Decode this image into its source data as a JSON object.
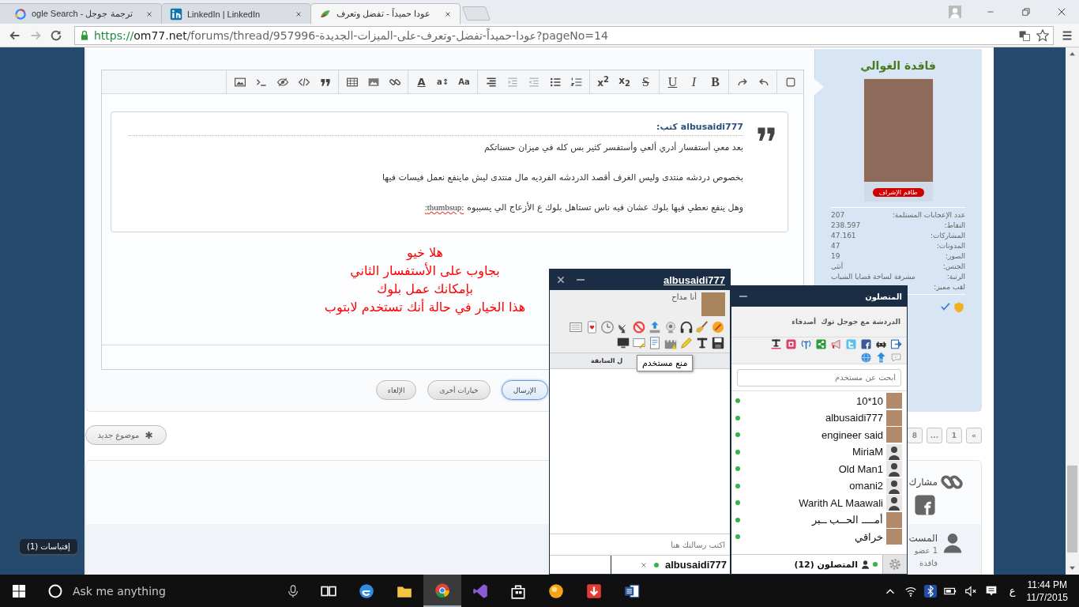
{
  "browser": {
    "tabs": [
      {
        "title": "عودا حميداً - تفضل وتعرف",
        "kind": "forum",
        "selected": true
      },
      {
        "title": "LinkedIn | LinkedIn",
        "kind": "linkedin",
        "selected": false
      },
      {
        "title": "ogle Search - ترجمة جوجل",
        "kind": "google",
        "selected": false
      }
    ],
    "address": {
      "secure": true,
      "scheme": "https://",
      "host": "om77.net",
      "path": "/forums/thread/957996-عودا-حميداً-تفضل-وتعرف-على-الميزات-الجديدة?pageNo=14"
    }
  },
  "editor": {
    "toolbar": [
      [
        {
          "kind": "square",
          "disabled": false
        }
      ],
      [
        {
          "kind": "undo",
          "disabled": false
        },
        {
          "kind": "redo",
          "disabled": false
        }
      ],
      [
        {
          "kind": "bold",
          "text": "B",
          "disabled": false
        },
        {
          "kind": "italic",
          "text": "I",
          "disabled": false
        },
        {
          "kind": "underline",
          "text": "U",
          "disabled": false
        }
      ],
      [
        {
          "kind": "strike",
          "text": "S",
          "disabled": false
        },
        {
          "kind": "subscript",
          "text": "x$_{2}$",
          "disabled": false
        },
        {
          "kind": "superscript",
          "text": "x$^{2}$",
          "disabled": false
        }
      ],
      [
        {
          "kind": "numbered",
          "disabled": false
        },
        {
          "kind": "bullets",
          "disabled": false
        },
        {
          "kind": "outdent",
          "disabled": true
        },
        {
          "kind": "indent",
          "disabled": true
        },
        {
          "kind": "align-right",
          "disabled": false
        }
      ],
      [
        {
          "kind": "font",
          "text": "Aa",
          "disabled": false
        },
        {
          "kind": "font-size",
          "text": "a↕",
          "disabled": false
        },
        {
          "kind": "text-color",
          "text": "A",
          "disabled": false
        }
      ],
      [
        {
          "kind": "link",
          "disabled": false
        },
        {
          "kind": "picture",
          "disabled": false
        },
        {
          "kind": "table",
          "disabled": false
        }
      ],
      [
        {
          "kind": "quote",
          "disabled": false
        },
        {
          "kind": "code",
          "disabled": false
        },
        {
          "kind": "hide",
          "disabled": false
        },
        {
          "kind": "terminal",
          "disabled": false
        },
        {
          "kind": "image",
          "disabled": false
        }
      ]
    ],
    "quote": {
      "author": "albusaidi777 كتب:",
      "lines": [
        {
          "text": "بعد معي أستفسار أدري ألعي وأستفسر كثير بس كله في ميزان حسناتكم"
        },
        {
          "text": "بخصوص دردشه منتدى وليس الغرف أقصد الدردشه الفرديه مال منتدى ليش ماينفع نعمل فيسات فيها"
        },
        {
          "text": "وهل ينفع نعطي فيها بلوك عشان فيه ناس تستاهل بلوك ع الأزعاج الي يسببوه",
          "flagged": ":thumbsup:"
        }
      ]
    },
    "reply_lines": [
      "هلا خيو",
      "بجاوب على الأستفسار الثاني",
      "بإمكانك عمل بلوك",
      "هذا الخيار في حالة أنك تستخدم لابتوب"
    ],
    "buttons": [
      {
        "label": "الإرسال",
        "primary": true
      },
      {
        "label": "خيارات أخرى",
        "primary": false
      },
      {
        "label": "الإلغاء",
        "primary": false
      }
    ]
  },
  "profile": {
    "name": "فاقدة الغوالي",
    "badge": "طاقم الإشراف",
    "stats": [
      {
        "label": "عدد الإعجابات المستلمة:",
        "value": "207"
      },
      {
        "label": "النقاط:",
        "value": "238.597"
      },
      {
        "label": "المشاركات:",
        "value": "47.161"
      },
      {
        "label": "المدونات:",
        "value": "47"
      },
      {
        "label": "الصور:",
        "value": "19"
      },
      {
        "label": "الجنس:",
        "value": "أنثى"
      },
      {
        "label": "الرتبة:",
        "value": "مشرفة لساحة قضايا الشباب"
      },
      {
        "label": "لقب مميز:"
      }
    ]
  },
  "new_topic_button": "موضوع جديد",
  "pagination": [
    "»",
    "1",
    "...",
    "8"
  ],
  "bottom_card": {
    "share_heading": "مشارك",
    "online_heading": "المست",
    "online_count": "1 عضو",
    "online_member": "فاقدة"
  },
  "quotes_badge": "إقتباسات (1)",
  "private_chat": {
    "title": "albusaidi777",
    "status": "أنا مداح",
    "tab_label": "ل السابقة",
    "input_placeholder": "اكتب رسالتك هنا",
    "minimized": {
      "name": "albusaidi777",
      "online": true
    }
  },
  "tooltip": "منع مستخدم",
  "online_window": {
    "title": "المتصلون",
    "links": [
      "الدردشة مع جوجل توك",
      "أصدقاء"
    ],
    "search_placeholder": "ابحث عن مستخدم",
    "users": [
      {
        "name": "10*10",
        "kind": "photo",
        "online": true
      },
      {
        "name": "albusaidi777",
        "kind": "photo",
        "online": true
      },
      {
        "name": "engineer said",
        "kind": "photo",
        "online": true
      },
      {
        "name": "MiriaM",
        "kind": "silhouette",
        "online": true
      },
      {
        "name": "Old Man1",
        "kind": "silhouette",
        "online": true
      },
      {
        "name": "omani2",
        "kind": "silhouette",
        "online": true
      },
      {
        "name": "Warith AL Maawali",
        "kind": "silhouette",
        "online": true
      },
      {
        "name": "أمــــ الحــب ــبر",
        "kind": "photo",
        "online": true
      },
      {
        "name": "خراقي",
        "kind": "photo",
        "online": true
      }
    ],
    "footer": "المتصلون (12)",
    "footer_online": true
  },
  "taskbar": {
    "search_placeholder": "Ask me anything",
    "apps": [
      {
        "kind": "task-view",
        "selected": false
      },
      {
        "kind": "edge",
        "selected": false
      },
      {
        "kind": "explorer",
        "selected": false
      },
      {
        "kind": "chrome",
        "selected": true
      },
      {
        "kind": "vs",
        "selected": false
      },
      {
        "kind": "store",
        "selected": false
      },
      {
        "kind": "sun",
        "selected": false
      },
      {
        "kind": "download",
        "selected": false
      },
      {
        "kind": "word",
        "selected": false
      }
    ],
    "language": "ع",
    "time": "11:44 PM",
    "date": "11/7/2015"
  }
}
